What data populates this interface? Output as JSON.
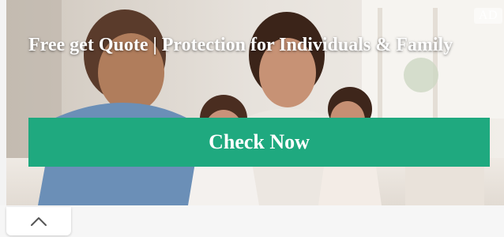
{
  "ad": {
    "badge": "AD",
    "headline": "Free get Quote | Protection for Individuals & Family",
    "cta_label": "Check Now",
    "image_icon": "family-photo",
    "colors": {
      "cta_background": "#1fa97f",
      "headline_text": "#ffffff"
    }
  },
  "collapse_control": {
    "icon": "chevron-up-icon"
  }
}
